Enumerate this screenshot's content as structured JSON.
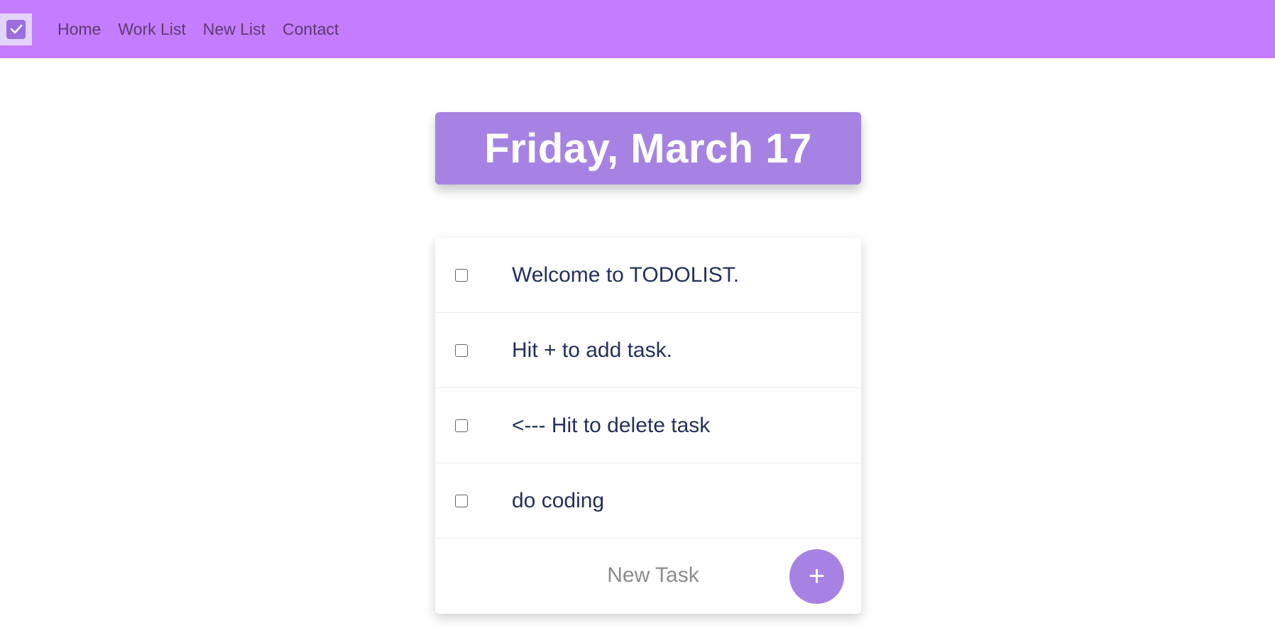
{
  "navbar": {
    "logo_icon": "check-square-icon",
    "links": [
      "Home",
      "Work List",
      "New List",
      "Contact"
    ],
    "background": "#c47dff"
  },
  "header": {
    "date_title": "Friday, March 17",
    "accent": "#a683e3"
  },
  "tasks": [
    {
      "text": "Welcome to TODOLIST.",
      "checked": false
    },
    {
      "text": "Hit + to add task.",
      "checked": false
    },
    {
      "text": "<--- Hit to delete task",
      "checked": false
    },
    {
      "text": "do coding",
      "checked": false
    }
  ],
  "new_task": {
    "placeholder": "New Task",
    "add_label": "+"
  }
}
